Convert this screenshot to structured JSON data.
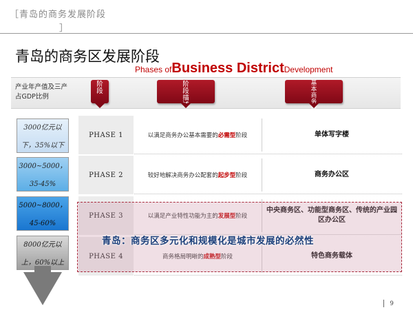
{
  "header": {
    "title": "［青岛的商务发展阶段",
    "bracket_close": "］"
  },
  "page_title": "青岛的商务区发展阶段",
  "subtitle": {
    "part1": "Phases of",
    "part2": "Business District",
    "part3": "Development"
  },
  "indicator_label": "产业年产值及三产占GDP比例",
  "banners": {
    "stage": "阶段",
    "description": "阶段描述",
    "features": "基本商务特征"
  },
  "levels": [
    {
      "line1": "3000亿元以",
      "line2": "下，35%以下"
    },
    {
      "line1": "3000~5000，",
      "line2": "35-45%"
    },
    {
      "line1": "5000~8000，",
      "line2": "45-60%"
    },
    {
      "line1": "8000亿元以",
      "line2": "上，60%以上"
    }
  ],
  "phases": [
    {
      "label": "PHASE 1",
      "desc_pre": "以满足商务办公基本需要的",
      "desc_hl": "必需型",
      "desc_post": "阶段",
      "feature": "单体写字楼"
    },
    {
      "label": "PHASE 2",
      "desc_pre": "较好地解决商务办公配套的",
      "desc_hl": "起步型",
      "desc_post": "阶段",
      "feature": "商务办公区"
    },
    {
      "label": "PHASE 3",
      "desc_pre": "以满足产业特性功能为主的",
      "desc_hl": "发展型",
      "desc_post": "阶段",
      "feature": "中央商务区、功能型商务区、传统的产业园区办公区"
    },
    {
      "label": "PHASE 4",
      "desc_pre": "商务格局明晰的",
      "desc_hl": "成熟型",
      "desc_post": "阶段",
      "feature": "特色商务载体"
    }
  ],
  "slogan": "青岛：商务区多元化和规模化是城市发展的必然性",
  "page_number": "9",
  "colors": {
    "accent_red": "#c00000",
    "banner_red": "#9e1020",
    "slogan_blue": "#1d3f7a"
  }
}
